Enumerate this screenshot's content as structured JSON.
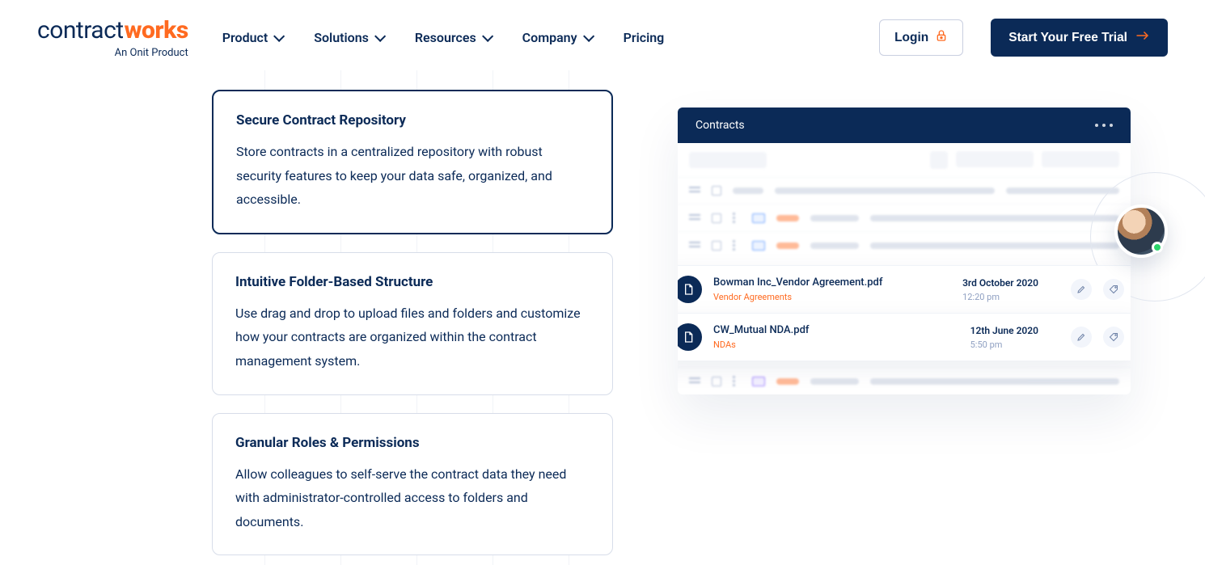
{
  "brand": {
    "logo_part1": "contract",
    "logo_part2": "works",
    "sub": "An Onit Product"
  },
  "nav": {
    "items": [
      {
        "label": "Product",
        "hasSubmenu": true
      },
      {
        "label": "Solutions",
        "hasSubmenu": true
      },
      {
        "label": "Resources",
        "hasSubmenu": true
      },
      {
        "label": "Company",
        "hasSubmenu": true
      },
      {
        "label": "Pricing",
        "hasSubmenu": false
      }
    ],
    "login": "Login",
    "cta": "Start Your Free Trial"
  },
  "features": [
    {
      "title": "Secure Contract Repository",
      "body": "Store contracts in a centralized repository with robust security features to keep your data safe, organized, and accessible.",
      "active": true
    },
    {
      "title": "Intuitive Folder-Based Structure",
      "body": "Use drag and drop to upload files and folders and customize how your contracts are organized within the contract management system.",
      "active": false
    },
    {
      "title": "Granular Roles & Permissions",
      "body": "Allow colleagues to self-serve the contract data they need with administrator-controlled access to folders and documents.",
      "active": false
    }
  ],
  "panel": {
    "header": "Contracts",
    "rows": [
      {
        "filename": "Bowman Inc_Vendor Agreement.pdf",
        "category": "Vendor Agreements",
        "date": "3rd October 2020",
        "time": "12:20 pm"
      },
      {
        "filename": "CW_Mutual NDA.pdf",
        "category": "NDAs",
        "date": "12th June 2020",
        "time": "5:50 pm"
      }
    ]
  }
}
